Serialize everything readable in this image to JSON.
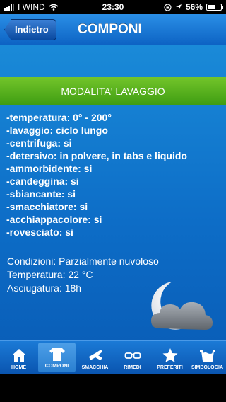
{
  "status": {
    "carrier": "I WIND",
    "time": "23:30",
    "battery": "56%",
    "battery_level": 0.56
  },
  "navbar": {
    "back_label": "Indietro",
    "title": "COMPONI"
  },
  "mode_title": "MODALITA' LAVAGGIO",
  "specs": [
    "-temperatura: 0° - 200°",
    "-lavaggio: ciclo lungo",
    "-centrifuga: si",
    "-detersivo: in polvere, in tabs e liquido",
    "-ammorbidente: si",
    "-candeggina: si",
    "-sbiancante: si",
    "-smacchiatore: si",
    "-acchiappacolore: si",
    "-rovesciato: si"
  ],
  "weather": {
    "conditions": "Condizioni: Parzialmente nuvoloso",
    "temperature": "Temperatura: 22 °C",
    "drying": "Asciugatura: 18h",
    "icon": "moon-cloud-icon"
  },
  "tabs": [
    {
      "label": "HOME",
      "icon": "home-icon"
    },
    {
      "label": "COMPONI",
      "icon": "shirt-icon"
    },
    {
      "label": "SMACCHIA",
      "icon": "stain-icon"
    },
    {
      "label": "RIMEDI",
      "icon": "glasses-icon"
    },
    {
      "label": "PREFERITI",
      "icon": "star-icon"
    },
    {
      "label": "SIMBOLOGIA",
      "icon": "washtub-icon"
    }
  ],
  "colors": {
    "nav_blue": "#0d63c4",
    "mode_green": "#5cb31f",
    "content_blue": "#1a8ad8"
  }
}
